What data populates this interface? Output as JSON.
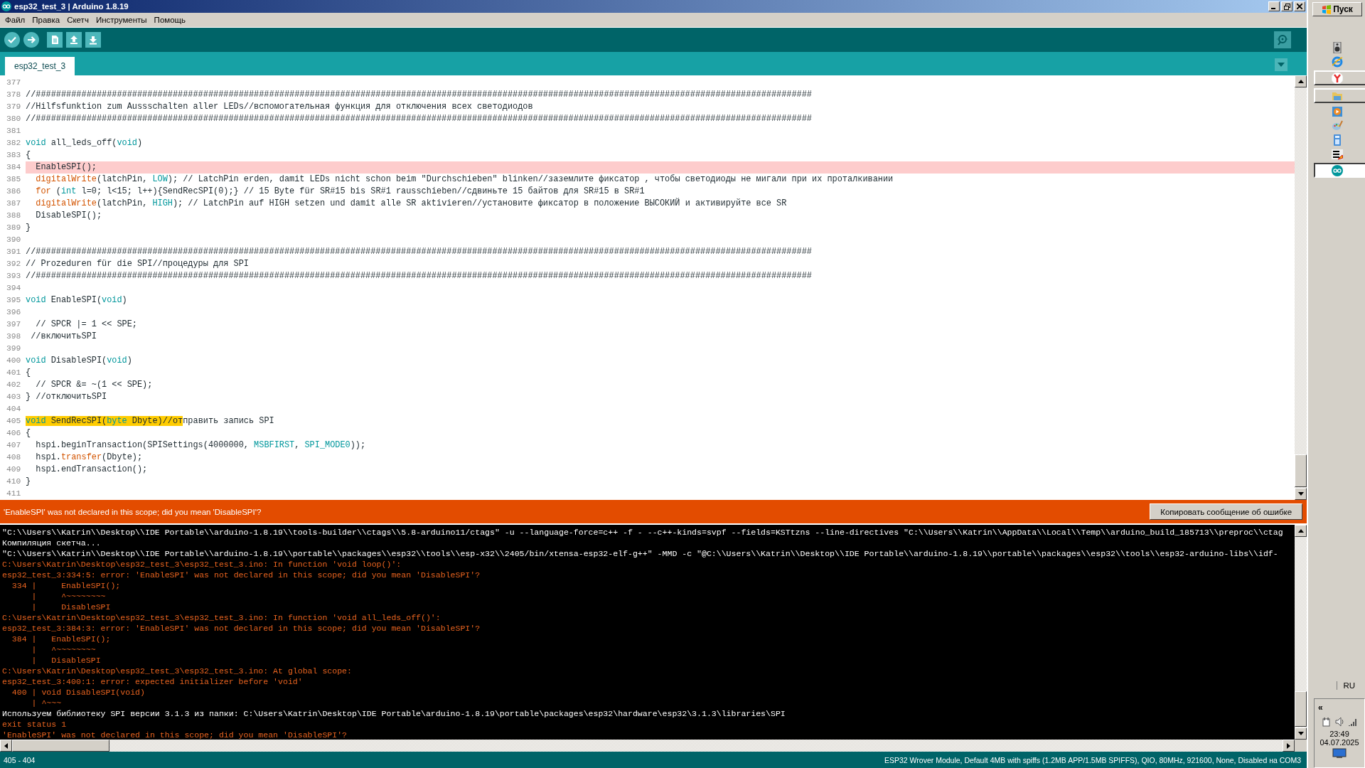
{
  "window": {
    "title": "esp32_test_3 | Arduino 1.8.19"
  },
  "menu": [
    "Файл",
    "Правка",
    "Скетч",
    "Инструменты",
    "Помощь"
  ],
  "tabs": [
    {
      "label": "esp32_test_3",
      "selected": true
    }
  ],
  "editor": {
    "lines": [
      {
        "number": "377",
        "error": false
      },
      {
        "number": "378",
        "error": false,
        "segments": [
          {
            "text": "//#########################################################################################################################################################",
            "kind": "plain"
          }
        ]
      },
      {
        "number": "379",
        "error": false,
        "segments": [
          {
            "text": "//Hilfsfunktion zum Aussschalten aller LEDs//вспомогательная функция для отключения всех светодиодов",
            "kind": "plain"
          }
        ]
      },
      {
        "number": "380",
        "error": false,
        "segments": [
          {
            "text": "//#########################################################################################################################################################",
            "kind": "plain"
          }
        ]
      },
      {
        "number": "381",
        "error": false
      },
      {
        "number": "382",
        "error": false,
        "segments": [
          {
            "text": "void",
            "kind": "keyword"
          },
          {
            "text": " all_leds_off(",
            "kind": "plain"
          },
          {
            "text": "void",
            "kind": "keyword"
          },
          {
            "text": ")",
            "kind": "plain"
          }
        ]
      },
      {
        "number": "383",
        "error": false,
        "segments": [
          {
            "text": "{",
            "kind": "plain"
          }
        ]
      },
      {
        "number": "384",
        "error": true,
        "segments": [
          {
            "text": "  EnableSPI();",
            "kind": "plain"
          }
        ]
      },
      {
        "number": "385",
        "error": false,
        "segments": [
          {
            "text": "  digitalWrite",
            "kind": "function"
          },
          {
            "text": "(latchPin, ",
            "kind": "plain"
          },
          {
            "text": "LOW",
            "kind": "keyword"
          },
          {
            "text": "); // LatchPin erden, damit LEDs nicht schon beim \"Durchschieben\" blinken//заземлите фиксатор , чтобы светодиоды не мигали при их проталкивании",
            "kind": "plain"
          }
        ]
      },
      {
        "number": "386",
        "error": false,
        "segments": [
          {
            "text": "  for",
            "kind": "function"
          },
          {
            "text": " (",
            "kind": "plain"
          },
          {
            "text": "int",
            "kind": "keyword"
          },
          {
            "text": " l=0; l<15; l++){SendRecSPI(0);} // 15 Byte für SR#15 bis SR#1 rausschieben//сдвиньте 15 байтов для SR#15 в SR#1",
            "kind": "plain"
          }
        ]
      },
      {
        "number": "387",
        "error": false,
        "segments": [
          {
            "text": "  digitalWrite",
            "kind": "function"
          },
          {
            "text": "(latchPin, ",
            "kind": "plain"
          },
          {
            "text": "HIGH",
            "kind": "keyword"
          },
          {
            "text": "); // LatchPin auf HIGH setzen und damit alle SR aktivieren//установите фиксатор в положение ВЫСОКИЙ и активируйте все SR",
            "kind": "plain"
          }
        ]
      },
      {
        "number": "388",
        "error": false,
        "segments": [
          {
            "text": "  DisableSPI();",
            "kind": "plain"
          }
        ]
      },
      {
        "number": "389",
        "error": false,
        "segments": [
          {
            "text": "}",
            "kind": "plain"
          }
        ]
      },
      {
        "number": "390",
        "error": false
      },
      {
        "number": "391",
        "error": false,
        "segments": [
          {
            "text": "//#########################################################################################################################################################",
            "kind": "plain"
          }
        ]
      },
      {
        "number": "392",
        "error": false,
        "segments": [
          {
            "text": "// Prozeduren für die SPI//процедуры для SPI",
            "kind": "plain"
          }
        ]
      },
      {
        "number": "393",
        "error": false,
        "segments": [
          {
            "text": "//#########################################################################################################################################################",
            "kind": "plain"
          }
        ]
      },
      {
        "number": "394",
        "error": false
      },
      {
        "number": "395",
        "error": false,
        "segments": [
          {
            "text": "void",
            "kind": "keyword"
          },
          {
            "text": " EnableSPI(",
            "kind": "plain"
          },
          {
            "text": "void",
            "kind": "keyword"
          },
          {
            "text": ")",
            "kind": "plain"
          }
        ]
      },
      {
        "number": "396",
        "error": false
      },
      {
        "number": "397",
        "error": false,
        "segments": [
          {
            "text": "  // SPCR |= 1 << SPE;",
            "kind": "plain"
          }
        ]
      },
      {
        "number": "398",
        "error": false,
        "segments": [
          {
            "text": " //включитьSPI",
            "kind": "plain"
          }
        ]
      },
      {
        "number": "399",
        "error": false
      },
      {
        "number": "400",
        "error": false,
        "segments": [
          {
            "text": "void",
            "kind": "keyword"
          },
          {
            "text": " DisableSPI(",
            "kind": "plain"
          },
          {
            "text": "void",
            "kind": "keyword"
          },
          {
            "text": ")",
            "kind": "plain"
          }
        ]
      },
      {
        "number": "401",
        "error": false,
        "segments": [
          {
            "text": "{",
            "kind": "plain"
          }
        ]
      },
      {
        "number": "402",
        "error": false,
        "segments": [
          {
            "text": "  // SPCR &= ~(1 << SPE);",
            "kind": "plain"
          }
        ]
      },
      {
        "number": "403",
        "error": false,
        "segments": [
          {
            "text": "} //отключитьSPI",
            "kind": "plain"
          }
        ]
      },
      {
        "number": "404",
        "error": false
      },
      {
        "number": "405",
        "error": false,
        "segments": [
          {
            "text": "void",
            "kind": "keyword",
            "selected": true
          },
          {
            "text": " SendRecSPI(",
            "kind": "plain",
            "selected": true
          },
          {
            "text": "byte",
            "kind": "keyword",
            "selected": true
          },
          {
            "text": " Dbyte)//от",
            "kind": "plain",
            "selected": true
          },
          {
            "text": "править запись SPI",
            "kind": "plain",
            "selected": false
          }
        ]
      },
      {
        "number": "406",
        "error": false,
        "segments": [
          {
            "text": "{",
            "kind": "plain"
          }
        ]
      },
      {
        "number": "407",
        "error": false,
        "segments": [
          {
            "text": "  hspi.beginTransaction(SPISettings(4000000, ",
            "kind": "plain"
          },
          {
            "text": "MSBFIRST",
            "kind": "keyword"
          },
          {
            "text": ", ",
            "kind": "plain"
          },
          {
            "text": "SPI_MODE0",
            "kind": "keyword"
          },
          {
            "text": "));",
            "kind": "plain"
          }
        ]
      },
      {
        "number": "408",
        "error": false,
        "segments": [
          {
            "text": "  hspi.",
            "kind": "plain"
          },
          {
            "text": "transfer",
            "kind": "function"
          },
          {
            "text": "(Dbyte);",
            "kind": "plain"
          }
        ]
      },
      {
        "number": "409",
        "error": false,
        "segments": [
          {
            "text": "  hspi.endTransaction();",
            "kind": "plain"
          }
        ]
      },
      {
        "number": "410",
        "error": false,
        "segments": [
          {
            "text": "}",
            "kind": "plain"
          }
        ]
      },
      {
        "number": "411",
        "error": false
      }
    ]
  },
  "error_bar": {
    "message": "'EnableSPI' was not declared in this scope; did you mean 'DisableSPI'?",
    "button": "Копировать сообщение об ошибке"
  },
  "console": {
    "lines": [
      {
        "kind": "info",
        "text": "\"C:\\\\Users\\\\Katrin\\\\Desktop\\\\IDE Portable\\\\arduino-1.8.19\\\\tools-builder\\\\ctags\\\\5.8-arduino11/ctags\" -u --language-force=c++ -f - --c++-kinds=svpf --fields=KSTtzns --line-directives \"C:\\\\Users\\\\Katrin\\\\AppData\\\\Local\\\\Temp\\\\arduino_build_185713\\\\preproc\\\\ctag"
      },
      {
        "kind": "info",
        "text": "Компиляция скетча..."
      },
      {
        "kind": "info",
        "text": "\"C:\\\\Users\\\\Katrin\\\\Desktop\\\\IDE Portable\\\\arduino-1.8.19\\\\portable\\\\packages\\\\esp32\\\\tools\\\\esp-x32\\\\2405/bin/xtensa-esp32-elf-g++\" -MMD -c \"@C:\\\\Users\\\\Katrin\\\\Desktop\\\\IDE Portable\\\\arduino-1.8.19\\\\portable\\\\packages\\\\esp32\\\\tools\\\\esp32-arduino-libs\\\\idf-"
      },
      {
        "kind": "error",
        "text": "C:\\Users\\Katrin\\Desktop\\esp32_test_3\\esp32_test_3.ino: In function 'void loop()':"
      },
      {
        "kind": "error",
        "text": "esp32_test_3:334:5: error: 'EnableSPI' was not declared in this scope; did you mean 'DisableSPI'?"
      },
      {
        "kind": "error",
        "text": "  334 |     EnableSPI();"
      },
      {
        "kind": "error",
        "text": "      |     ^~~~~~~~~"
      },
      {
        "kind": "error",
        "text": "      |     DisableSPI"
      },
      {
        "kind": "error",
        "text": "C:\\Users\\Katrin\\Desktop\\esp32_test_3\\esp32_test_3.ino: In function 'void all_leds_off()':"
      },
      {
        "kind": "error",
        "text": "esp32_test_3:384:3: error: 'EnableSPI' was not declared in this scope; did you mean 'DisableSPI'?"
      },
      {
        "kind": "error",
        "text": "  384 |   EnableSPI();"
      },
      {
        "kind": "error",
        "text": "      |   ^~~~~~~~~"
      },
      {
        "kind": "error",
        "text": "      |   DisableSPI"
      },
      {
        "kind": "error",
        "text": "C:\\Users\\Katrin\\Desktop\\esp32_test_3\\esp32_test_3.ino: At global scope:"
      },
      {
        "kind": "error",
        "text": "esp32_test_3:400:1: error: expected initializer before 'void'"
      },
      {
        "kind": "error",
        "text": "  400 | void DisableSPI(void)"
      },
      {
        "kind": "error",
        "text": "      | ^~~~"
      },
      {
        "kind": "info",
        "text": "Используем библиотеку SPI версии 3.1.3 из папки: C:\\Users\\Katrin\\Desktop\\IDE Portable\\arduino-1.8.19\\portable\\packages\\esp32\\hardware\\esp32\\3.1.3\\libraries\\SPI"
      },
      {
        "kind": "error",
        "text": "exit status 1"
      },
      {
        "kind": "error",
        "text": "'EnableSPI' was not declared in this scope; did you mean 'DisableSPI'?"
      }
    ]
  },
  "status_bar": {
    "position": "405 - 404",
    "board": "ESP32 Wrover Module, Default 4MB with spiffs (1.2MB APP/1.5MB SPIFFS), QIO, 80MHz, 921600, None, Disabled на COM3"
  },
  "taskbar": {
    "start": "Пуск",
    "items": [
      {
        "kind": "icon"
      },
      {
        "kind": "icon"
      },
      {
        "kind": "button",
        "selected": false
      },
      {
        "kind": "button",
        "selected": false
      },
      {
        "kind": "icon"
      },
      {
        "kind": "icon"
      },
      {
        "kind": "icon"
      },
      {
        "kind": "icon"
      },
      {
        "kind": "button",
        "selected": true
      }
    ],
    "language": "RU",
    "tray_toggle": "«",
    "time": "23:49",
    "date": "04.07.2025"
  }
}
